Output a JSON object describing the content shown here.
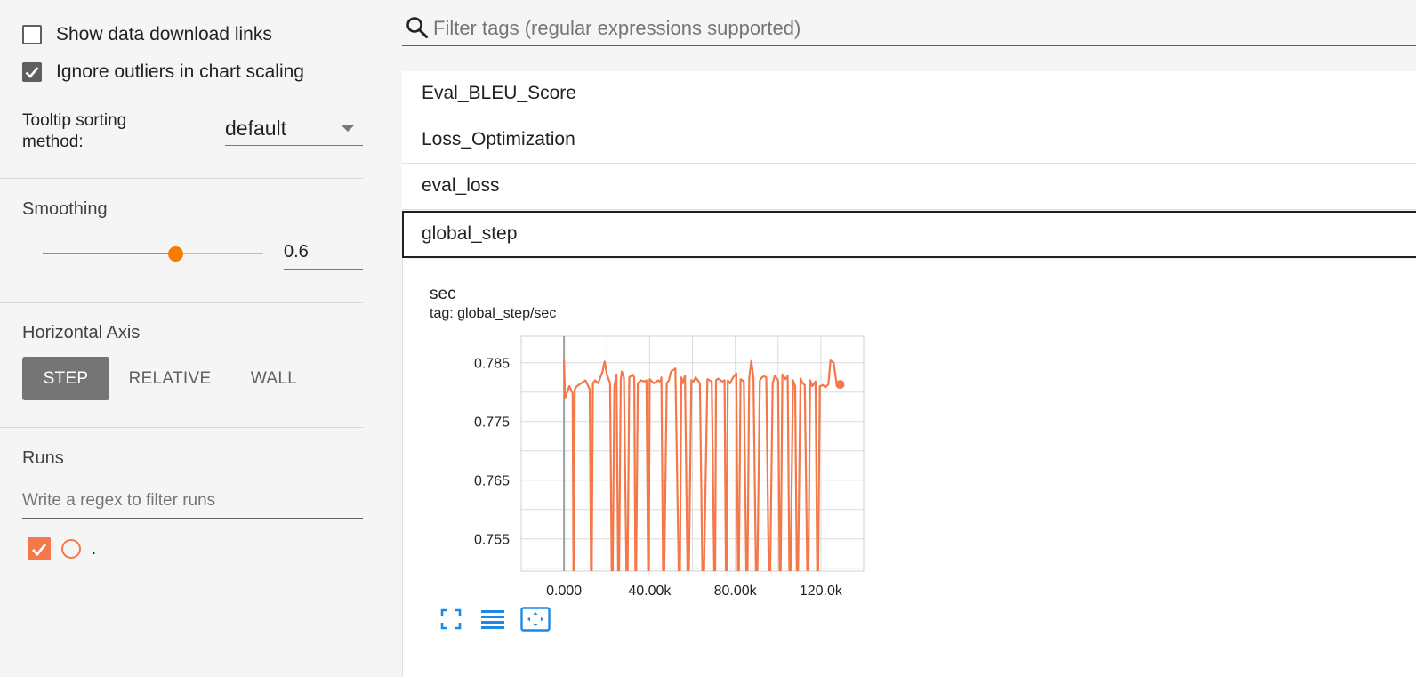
{
  "sidebar": {
    "show_download_links": {
      "label": "Show data download links",
      "checked": false
    },
    "ignore_outliers": {
      "label": "Ignore outliers in chart scaling",
      "checked": true
    },
    "tooltip_sorting": {
      "label": "Tooltip sorting method:",
      "value": "default"
    },
    "smoothing": {
      "title": "Smoothing",
      "value": "0.6",
      "fraction": 0.6
    },
    "horizontal_axis": {
      "title": "Horizontal Axis",
      "options": [
        {
          "label": "STEP",
          "active": true
        },
        {
          "label": "RELATIVE",
          "active": false
        },
        {
          "label": "WALL",
          "active": false
        }
      ]
    },
    "runs": {
      "title": "Runs",
      "filter_placeholder": "Write a regex to filter runs",
      "items": [
        {
          "name": ".",
          "checked": true,
          "color": "#f4784a"
        }
      ]
    }
  },
  "main": {
    "search_placeholder": "Filter tags (regular expressions supported)",
    "categories": [
      {
        "label": "Eval_BLEU_Score",
        "open": false
      },
      {
        "label": "Loss_Optimization",
        "open": false
      },
      {
        "label": "eval_loss",
        "open": false
      },
      {
        "label": "global_step",
        "open": true
      }
    ],
    "card": {
      "title": "sec",
      "tag": "tag: global_step/sec",
      "tools": [
        "fit-to-screen-icon",
        "toggle-log-scale-icon",
        "fit-domain-icon"
      ]
    }
  },
  "colors": {
    "accent": "#f57c00",
    "series": "#f4784a",
    "link_icons": "#1e88e5"
  },
  "chart_data": {
    "type": "line",
    "title": "sec",
    "xlabel": "",
    "ylabel": "",
    "xlim": [
      -20000,
      140000
    ],
    "ylim": [
      0.7495,
      0.7895
    ],
    "x_ticks": [
      0,
      40000,
      80000,
      120000
    ],
    "x_tick_labels": [
      "0.000",
      "40.00k",
      "80.00k",
      "120.0k"
    ],
    "y_ticks": [
      0.755,
      0.765,
      0.775,
      0.785
    ],
    "y_tick_labels": [
      "0.755",
      "0.765",
      "0.775",
      "0.785"
    ],
    "grid": true,
    "series": [
      {
        "x": [
          0,
          500,
          2500,
          4000,
          4500,
          5000,
          6000,
          8000,
          10000,
          12000,
          12800,
          13500,
          14500,
          16000,
          18000,
          19000,
          20000,
          21500,
          22500,
          23500,
          24500,
          25500,
          26500,
          27000,
          28000,
          29500,
          30500,
          32000,
          32800,
          33500,
          34500,
          36000,
          37500,
          38500,
          39500,
          40000,
          42000,
          44000,
          45000,
          45500,
          46500,
          48000,
          49000,
          50000,
          52000,
          54000,
          54800,
          55500,
          56500,
          58000,
          59500,
          60500,
          61500,
          62500,
          63500,
          65000,
          67000,
          69000,
          70500,
          71000,
          72000,
          74000,
          75000,
          75800,
          76500,
          77500,
          79000,
          80500,
          81500,
          82500,
          84000,
          85500,
          86500,
          87500,
          88500,
          90000,
          91500,
          92500,
          93500,
          94500,
          96000,
          97500,
          98500,
          100000,
          101000,
          102000,
          103500,
          104500,
          105500,
          107000,
          108000,
          109000,
          110500,
          111500,
          112500,
          114000,
          115000,
          116000,
          117500,
          118500,
          119500,
          121000,
          122000,
          123500,
          124500,
          126000,
          127500,
          129000
        ],
        "y": [
          0.7855,
          0.779,
          0.781,
          0.7798,
          0.74,
          0.7805,
          0.781,
          0.7815,
          0.782,
          0.7805,
          0.74,
          0.7815,
          0.782,
          0.7815,
          0.7835,
          0.7852,
          0.783,
          0.7815,
          0.74,
          0.781,
          0.783,
          0.74,
          0.782,
          0.7835,
          0.7825,
          0.74,
          0.7825,
          0.783,
          0.7825,
          0.74,
          0.7815,
          0.782,
          0.7818,
          0.782,
          0.74,
          0.7822,
          0.7815,
          0.782,
          0.7817,
          0.7825,
          0.74,
          0.7815,
          0.782,
          0.7835,
          0.784,
          0.74,
          0.7825,
          0.7815,
          0.7828,
          0.74,
          0.782,
          0.7818,
          0.7825,
          0.782,
          0.7815,
          0.74,
          0.7822,
          0.7818,
          0.74,
          0.782,
          0.7823,
          0.7818,
          0.782,
          0.74,
          0.782,
          0.7815,
          0.7825,
          0.7832,
          0.74,
          0.7822,
          0.7818,
          0.74,
          0.7823,
          0.7853,
          0.7825,
          0.74,
          0.782,
          0.7825,
          0.7827,
          0.7825,
          0.74,
          0.7815,
          0.7828,
          0.782,
          0.74,
          0.783,
          0.7822,
          0.7828,
          0.74,
          0.782,
          0.781,
          0.74,
          0.7823,
          0.7815,
          0.7812,
          0.74,
          0.782,
          0.781,
          0.7818,
          0.74,
          0.781,
          0.7812,
          0.7808,
          0.7813,
          0.7854,
          0.785,
          0.781,
          0.7813
        ]
      }
    ]
  }
}
